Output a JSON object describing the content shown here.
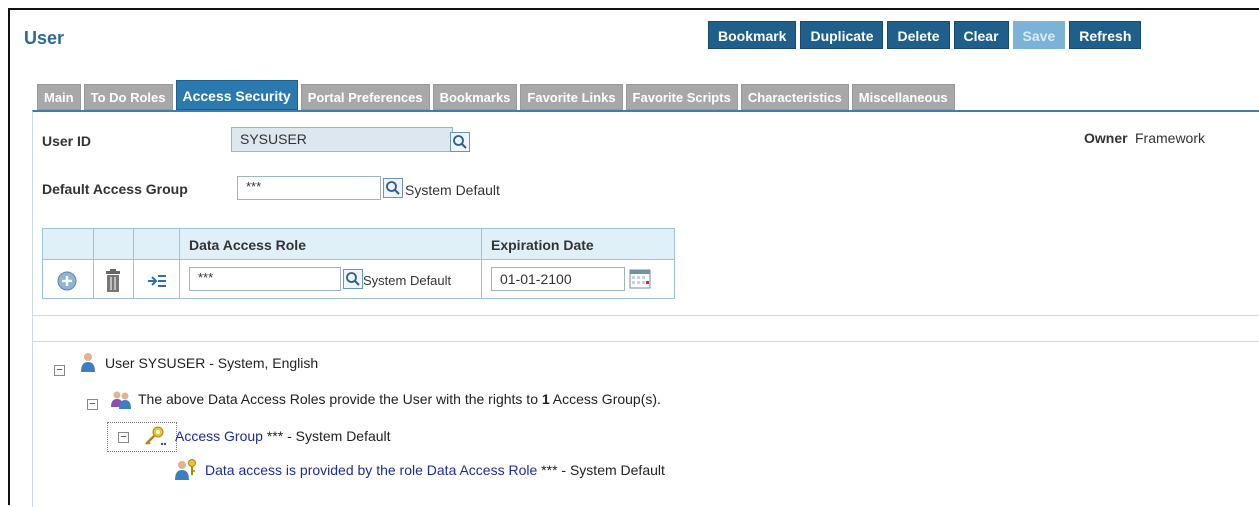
{
  "app": {
    "title": "User"
  },
  "toolbar": {
    "bookmark": "Bookmark",
    "duplicate": "Duplicate",
    "delete": "Delete",
    "clear": "Clear",
    "save": "Save",
    "refresh": "Refresh"
  },
  "tabs": [
    {
      "label": "Main"
    },
    {
      "label": "To Do Roles"
    },
    {
      "label": "Access Security"
    },
    {
      "label": "Portal Preferences"
    },
    {
      "label": "Bookmarks"
    },
    {
      "label": "Favorite Links"
    },
    {
      "label": "Favorite Scripts"
    },
    {
      "label": "Characteristics"
    },
    {
      "label": "Miscellaneous"
    }
  ],
  "form": {
    "user_id_label": "User ID",
    "user_id_value": "SYSUSER",
    "owner_label": "Owner",
    "owner_value": "Framework",
    "default_access_group_label": "Default Access Group",
    "default_access_group_value": "***",
    "default_access_group_desc": "System Default"
  },
  "grid": {
    "col_role": "Data Access Role",
    "col_expiration": "Expiration Date",
    "rows": [
      {
        "role": "***",
        "role_desc": "System Default",
        "expiration": "01-01-2100"
      }
    ]
  },
  "tree": {
    "user_line": "User SYSUSER - System, English",
    "rights_prefix": "The above Data Access Roles provide the User with the rights to ",
    "rights_count": "1",
    "rights_suffix": " Access Group(s).",
    "access_group_link": "Access Group",
    "access_group_code": "***",
    "access_group_desc": " - System Default",
    "data_access_link": "Data access is provided by the role Data Access Role",
    "data_access_code": "***",
    "data_access_desc": " - System Default"
  },
  "colors": {
    "accent": "#1f5f8c",
    "active_tab": "#2a7ab0",
    "inactive_tab": "#a8a8a8",
    "title": "#2a6a97",
    "link": "#1c2b9c"
  }
}
